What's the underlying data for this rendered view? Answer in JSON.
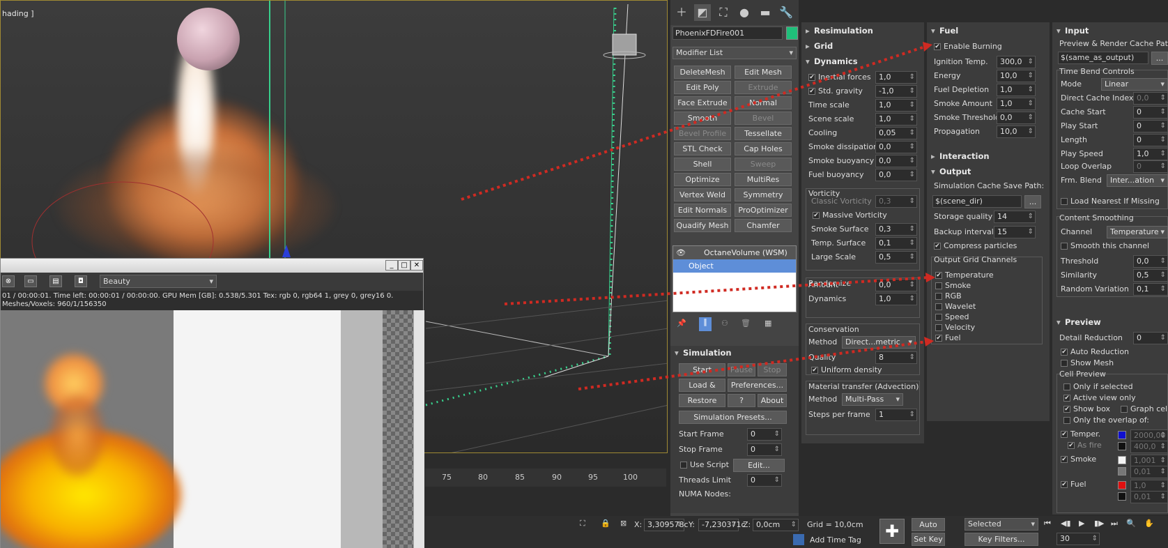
{
  "viewport": {
    "label": "hading ]",
    "timeline_ticks": [
      "75",
      "80",
      "85",
      "90",
      "95",
      "100"
    ]
  },
  "vfb": {
    "channel": "Beauty",
    "status_line1": "01 / 00:00:01.  Time left: 00:00:01 / 00:00:00.  GPU Mem [GB]: 0.538/5.301  Tex: rgb 0, rgb64 1, grey 0, grey16 0.",
    "status_line2": "Meshes/Voxels: 960/1/156350",
    "min": "_",
    "max": "□",
    "close": "✕"
  },
  "cmd": {
    "object_name": "PhoenixFDFire001",
    "object_color": "#1fbf7a",
    "modifier_list": "Modifier List",
    "buttons": [
      [
        "DeleteMesh",
        "Edit Mesh"
      ],
      [
        "Edit Poly",
        "Extrude"
      ],
      [
        "Face Extrude",
        "Normal"
      ],
      [
        "Smooth",
        "Bevel"
      ],
      [
        "Bevel Profile",
        "Tessellate"
      ],
      [
        "STL Check",
        "Cap Holes"
      ],
      [
        "Shell",
        "Sweep"
      ],
      [
        "Optimize",
        "MultiRes"
      ],
      [
        "Vertex Weld",
        "Symmetry"
      ],
      [
        "Edit Normals",
        "ProOptimizer"
      ],
      [
        "Quadify Mesh",
        "Chamfer"
      ]
    ],
    "stack": [
      "OctaneVolume (WSM)",
      "Object"
    ],
    "sim_title": "Simulation",
    "start": "Start",
    "pause": "Pause",
    "stop": "Stop",
    "load_start": "Load & Start",
    "prefs": "Preferences...",
    "restore": "Restore",
    "help": "?",
    "about": "About",
    "presets": "Simulation Presets...",
    "start_frame_lbl": "Start Frame",
    "start_frame": "0",
    "stop_frame_lbl": "Stop Frame",
    "stop_frame": "0",
    "use_script": "Use Script",
    "edit": "Edit...",
    "threads_lbl": "Threads Limit",
    "threads": "0",
    "numa": "NUMA Nodes:"
  },
  "dyn": {
    "resim": "Resimulation",
    "grid": "Grid",
    "dynamics": "Dynamics",
    "inertial_lbl": "Inertial forces",
    "inertial": "1,0",
    "gravity_lbl": "Std. gravity",
    "gravity": "-1,0",
    "timescale_lbl": "Time scale",
    "timescale": "1,0",
    "scenescale_lbl": "Scene scale",
    "scenescale": "1,0",
    "cooling_lbl": "Cooling",
    "cooling": "0,05",
    "smokediss_lbl": "Smoke dissipation",
    "smokediss": "0,0",
    "smokebuoy_lbl": "Smoke buoyancy",
    "smokebuoy": "0,0",
    "fuelbuoy_lbl": "Fuel buoyancy",
    "fuelbuoy": "0,0",
    "vorticity": "Vorticity",
    "classic_lbl": "Classic Vorticity",
    "classic": "0,3",
    "massive": "Massive Vorticity",
    "smokesurf_lbl": "Smoke Surface",
    "smokesurf": "0,3",
    "tempsurf_lbl": "Temp. Surface",
    "tempsurf": "0,1",
    "largescale_lbl": "Large Scale",
    "largescale": "0,5",
    "randomize": "Randomize",
    "amount_lbl": "Amount",
    "amount": "0,0",
    "rdyn_lbl": "Dynamics",
    "rdyn": "1,0",
    "conservation": "Conservation",
    "method_lbl": "Method",
    "method": "Direct...metric",
    "quality_lbl": "Quality",
    "quality": "8",
    "uniform": "Uniform density",
    "advection": "Material transfer (Advection)",
    "adv_method_lbl": "Method",
    "adv_method": "Multi-Pass",
    "steps_lbl": "Steps per frame",
    "steps": "1"
  },
  "fuel": {
    "title": "Fuel",
    "enable": "Enable Burning",
    "ign_lbl": "Ignition Temp.",
    "ign": "300,0",
    "energy_lbl": "Energy",
    "energy": "10,0",
    "depl_lbl": "Fuel Depletion",
    "depl": "1,0",
    "smokeamt_lbl": "Smoke Amount",
    "smokeamt": "1,0",
    "smokethr_lbl": "Smoke Threshold",
    "smokethr": "0,0",
    "prop_lbl": "Propagation",
    "prop": "10,0",
    "interaction": "Interaction",
    "output": "Output",
    "cache_lbl": "Simulation Cache Save Path:",
    "cache": "$(scene_dir)",
    "browse": "...",
    "storage_lbl": "Storage quality",
    "storage": "14",
    "backup_lbl": "Backup interval",
    "backup": "15",
    "compress": "Compress particles",
    "channels_title": "Output Grid Channels",
    "channels": [
      "Temperature",
      "Smoke",
      "RGB",
      "Wavelet",
      "Speed",
      "Velocity",
      "Fuel"
    ]
  },
  "input": {
    "title": "Input",
    "preview_path_lbl": "Preview & Render Cache Path",
    "preview_path": "$(same_as_output)",
    "tbc": "Time Bend Controls",
    "mode_lbl": "Mode",
    "mode": "Linear",
    "dci_lbl": "Direct Cache Index",
    "dci": "0,0",
    "cs_lbl": "Cache Start",
    "cs": "0",
    "ps_lbl": "Play Start",
    "ps": "0",
    "len_lbl": "Length",
    "len": "0",
    "speed_lbl": "Play Speed",
    "speed": "1,0",
    "loop_lbl": "Loop Overlap",
    "loop": "0",
    "blend_lbl": "Frm. Blend",
    "blend": "Inter...ation",
    "lnm": "Load Nearest If Missing",
    "smoothing": "Content Smoothing",
    "chan_lbl": "Channel",
    "chan": "Temperature",
    "smooth_ch": "Smooth this channel",
    "thr_lbl": "Threshold",
    "thr": "0,0",
    "sim_lbl": "Similarity",
    "sim": "0,5",
    "rv_lbl": "Random Variation",
    "rv": "0,1",
    "preview": "Preview",
    "dr_lbl": "Detail Reduction",
    "dr": "0",
    "auto": "Auto Reduction",
    "showmesh": "Show Mesh",
    "cellprev": "Cell Preview",
    "onlysel": "Only if selected",
    "active": "Active view only",
    "showbox": "Show box",
    "graphcells": "Graph cells",
    "overlap": "Only the overlap of:",
    "temper": "Temper.",
    "temper_v": "2000,00",
    "asfire": "As fire",
    "asfire_v": "400,0",
    "smoke": "Smoke",
    "smoke_v": "1,001",
    "smoke_v2": "0,01",
    "fuel": "Fuel",
    "fuel_v": "1,0",
    "fuel_v2": "0,01"
  },
  "bottom": {
    "x_lbl": "X:",
    "x": "3,309578c",
    "y_lbl": "Y:",
    "y": "-7,230371c",
    "z_lbl": "Z:",
    "z": "0,0cm",
    "grid": "Grid = 10,0cm",
    "addtime": "Add Time Tag",
    "autokey": "Auto Key",
    "setkey": "Set Key",
    "selected": "Selected",
    "keyfilters": "Key Filters...",
    "frame": "30"
  }
}
